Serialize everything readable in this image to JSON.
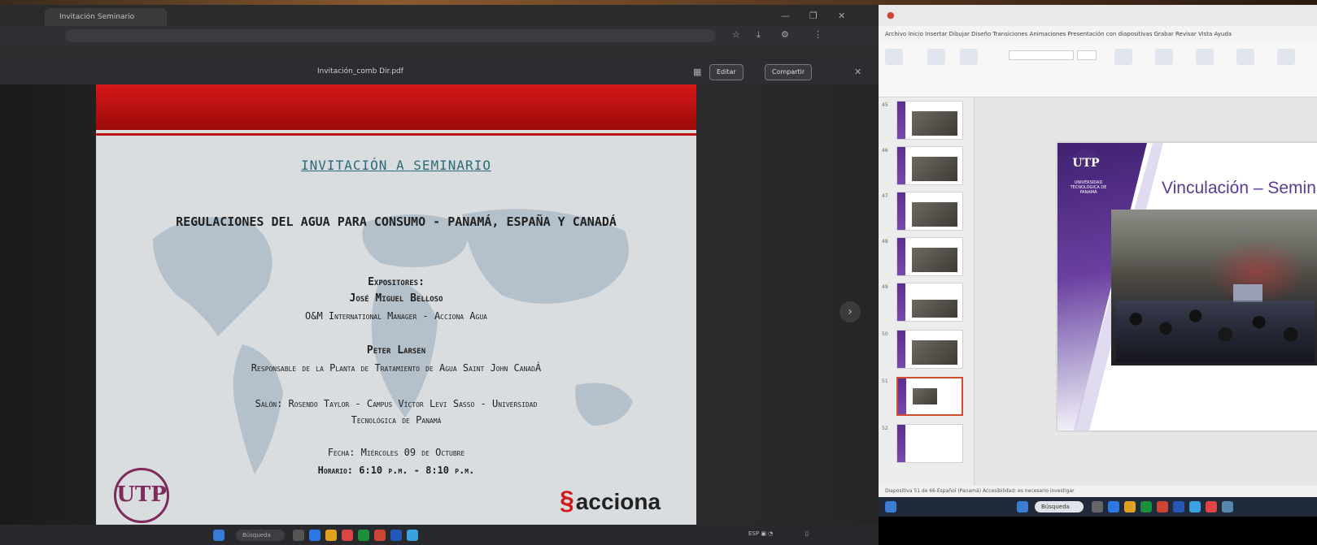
{
  "left_window": {
    "tab_title": "Invitación Seminario",
    "url": "",
    "bookmarks": "",
    "pdf": {
      "file_name": "Invitación_comb Dir.pdf",
      "edit_label": "Editar",
      "share_label": "Compartir",
      "heading": "INVITACIÓN A SEMINARIO",
      "title": "REGULACIONES DEL AGUA PARA CONSUMO - PANAMÁ, ESPAÑA Y CANADÁ",
      "speakers_label": "Expositores:",
      "speaker1_name": "José Miguel Belloso",
      "speaker1_role": "O&M International Manager - Acciona Agua",
      "speaker2_name": "Peter Larsen",
      "speaker2_role": "Responsable de la Planta de Tratamiento de Agua Saint John CanadÁ",
      "venue_line1": "Salón: Rosendo Taylor - Campus Víctor Levi Sasso - Universidad",
      "venue_line2": "Tecnológica de Panamá",
      "date": "Fecha: Miércoles 09 de Octubre",
      "time": "Horario: 6:10 p.m. - 8:10 p.m.",
      "logo_left": "UTP",
      "logo_right": "acciona"
    },
    "taskbar": {
      "search": "Búsqueda"
    }
  },
  "right_window": {
    "menu": "Archivo   Inicio   Insertar   Dibujar   Diseño   Transiciones   Animaciones   Presentación con diapositivas   Grabar   Revisar   Vista   Ayuda",
    "slide_title": "Vinculación – Seminario",
    "logo_text": "UNIVERSIDAD TECNOLÓGICA DE PANAMÁ",
    "thumb_numbers": [
      "45",
      "46",
      "47",
      "48",
      "49",
      "50",
      "51",
      "52"
    ],
    "status": "Diapositiva 51 de 66      Español (Panamá)      Accesibilidad: es necesario investigar",
    "taskbar_search": "Búsqueda"
  },
  "colors": {
    "pdf_red": "#c01212",
    "utp_purple": "#5b3a96",
    "acciona_red": "#d11c1c"
  }
}
